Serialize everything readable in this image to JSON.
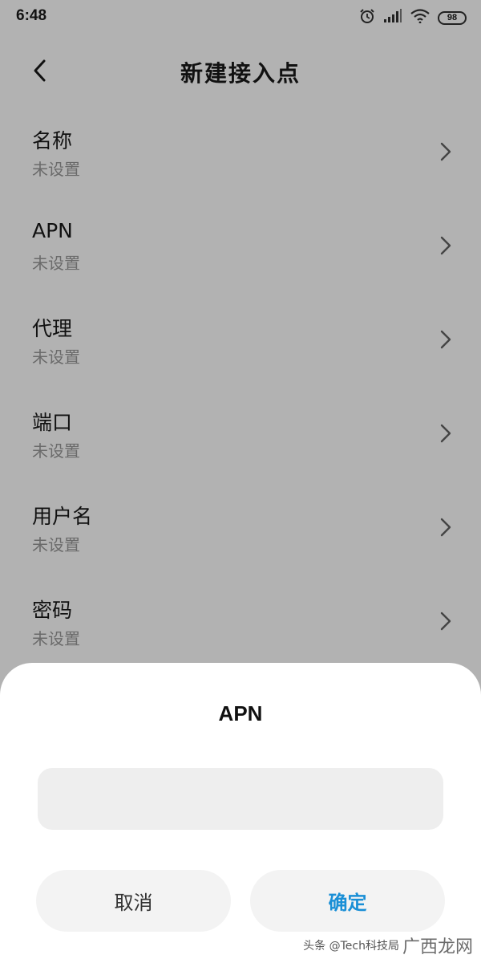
{
  "status_bar": {
    "time": "6:48",
    "battery": "98",
    "icons": [
      "alarm-icon",
      "signal-icon",
      "wifi-icon",
      "battery-icon"
    ]
  },
  "header": {
    "title": "新建接入点",
    "back_icon": "chevron-left-icon"
  },
  "settings": {
    "items": [
      {
        "label": "名称",
        "value": "未设置"
      },
      {
        "label": "APN",
        "value": "未设置"
      },
      {
        "label": "代理",
        "value": "未设置"
      },
      {
        "label": "端口",
        "value": "未设置"
      },
      {
        "label": "用户名",
        "value": "未设置"
      },
      {
        "label": "密码",
        "value": "未设置"
      }
    ]
  },
  "dialog": {
    "title": "APN",
    "input_value": "",
    "cancel_label": "取消",
    "confirm_label": "确定"
  },
  "watermark": {
    "text": "头条 @Tech科技局",
    "logo_text": "广西龙网"
  },
  "colors": {
    "dimmed_background": "#b2b2b2",
    "sheet_background": "#ffffff",
    "confirm_accent": "#1a8fd6",
    "input_background": "#eeeeee"
  }
}
